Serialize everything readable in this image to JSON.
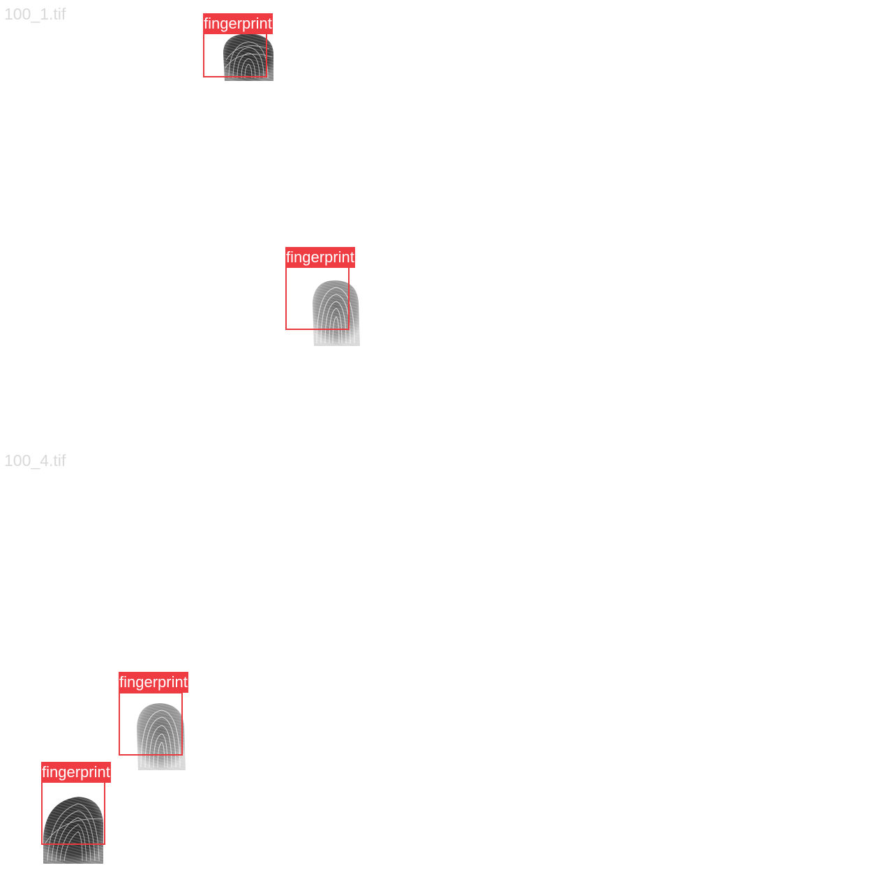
{
  "panels": [
    {
      "filename": "100_1.tif",
      "detections": [
        {
          "label": "fingerprint"
        },
        {
          "label": "fingerprint"
        }
      ]
    },
    {
      "filename": "100_4.tif",
      "detections": [
        {
          "label": "fingerprint"
        },
        {
          "label": "fingerprint"
        }
      ]
    }
  ],
  "colors": {
    "box": "#e8393f",
    "label_background": "#ef3b42",
    "label_text": "#ffffff",
    "filename_text": "#d9d9d9"
  }
}
